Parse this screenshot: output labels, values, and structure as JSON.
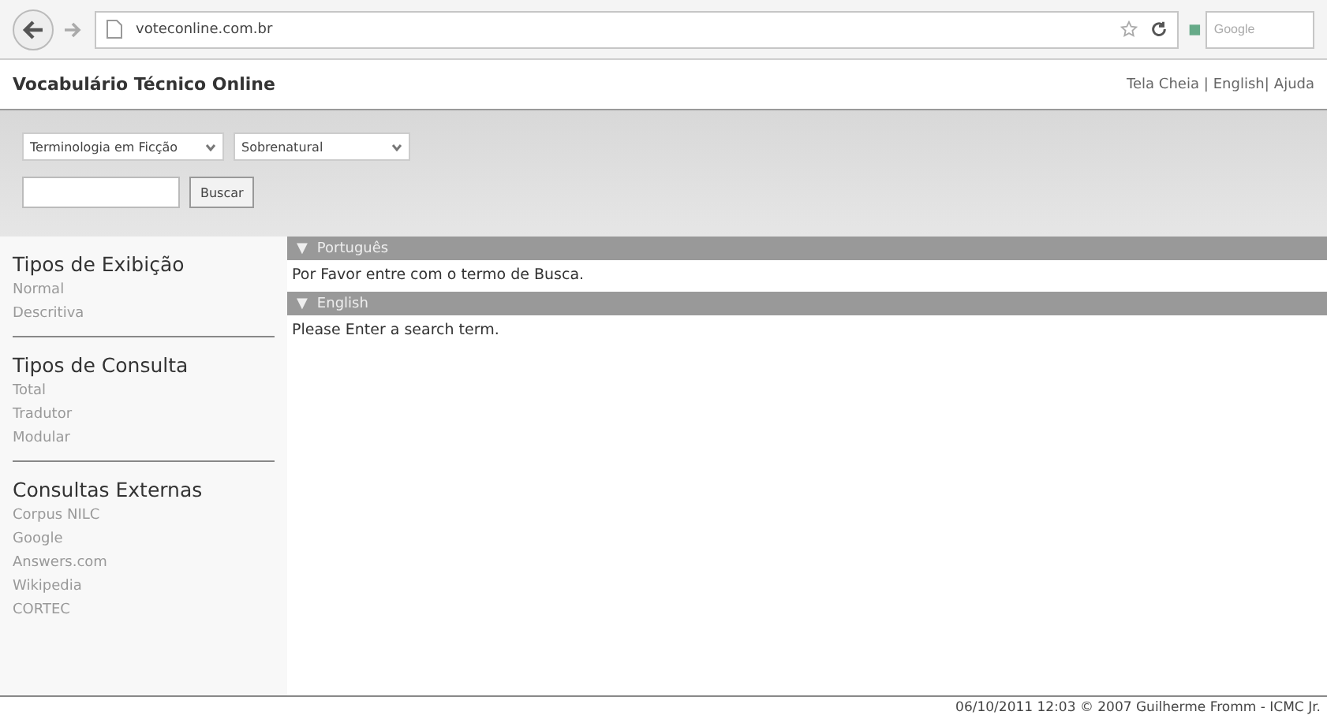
{
  "browser": {
    "url": "voteconline.com.br",
    "search_placeholder": "Google"
  },
  "site": {
    "title": "Vocabulário Técnico Online",
    "top_links": [
      "Tela Cheia |",
      "English|",
      "Ajuda"
    ]
  },
  "search_bar": {
    "selects": [
      {
        "value": "Terminologia em Ficção"
      },
      {
        "value": "Sobrenatural"
      }
    ],
    "button": "Buscar"
  },
  "sidebar": [
    {
      "heading": "Tipos de Exibição",
      "items": [
        "Normal",
        "Descritiva"
      ]
    },
    {
      "heading": "Tipos de Consulta",
      "items": [
        "Total",
        "Tradutor",
        "Modular"
      ]
    },
    {
      "heading": "Consultas Externas",
      "items": [
        "Corpus NILC",
        "Google",
        "Answers.com",
        "Wikipedia",
        "CORTEC"
      ]
    }
  ],
  "sections": [
    {
      "toggle": "▼",
      "title": "Português",
      "expanded": true,
      "body": "Por Favor entre com o termo de Busca."
    },
    {
      "toggle": "▼",
      "title": "English",
      "expanded": true,
      "body": "Please Enter a search term."
    }
  ],
  "footer": "06/10/2011 12:03 © 2007 Guilherme Fromm - ICMC Jr."
}
